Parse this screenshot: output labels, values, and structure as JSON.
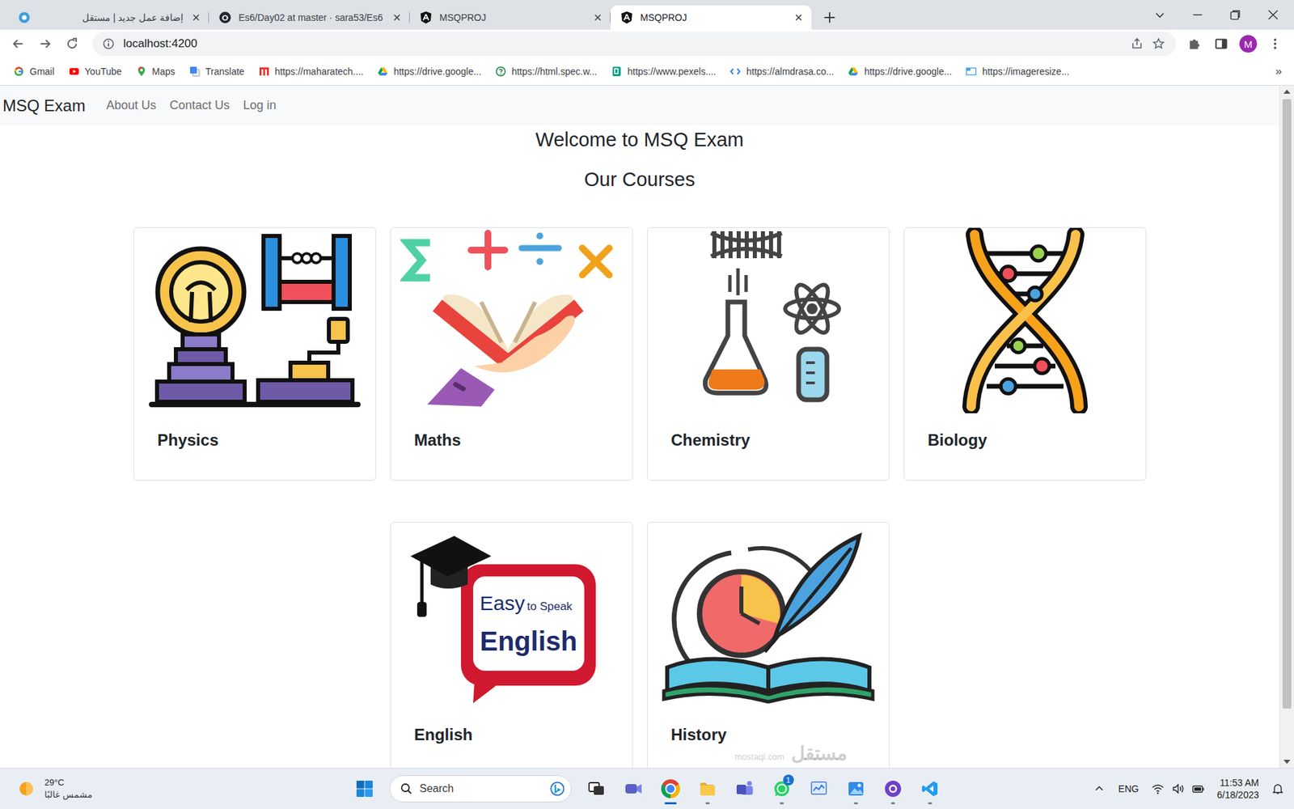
{
  "browser": {
    "tabs": [
      {
        "label": "إضافة عمل جديد | مستقل",
        "kind": "mostaql",
        "selected": false
      },
      {
        "label": "Es6/Day02 at master · sara53/Es6",
        "kind": "github",
        "selected": false
      },
      {
        "label": "MSQPROJ",
        "kind": "angular",
        "selected": false
      },
      {
        "label": "MSQPROJ",
        "kind": "angular",
        "selected": true
      }
    ],
    "address": "localhost:4200",
    "profile_initial": "M",
    "bookmarks": [
      {
        "label": "Gmail",
        "kind": "google"
      },
      {
        "label": "YouTube",
        "kind": "youtube"
      },
      {
        "label": "Maps",
        "kind": "maps"
      },
      {
        "label": "Translate",
        "kind": "translate"
      },
      {
        "label": "https://maharatech....",
        "kind": "maharatech"
      },
      {
        "label": "https://drive.google...",
        "kind": "drive"
      },
      {
        "label": "https://html.spec.w...",
        "kind": "help"
      },
      {
        "label": "https://www.pexels....",
        "kind": "pexels"
      },
      {
        "label": "https://almdrasa.co...",
        "kind": "code"
      },
      {
        "label": "https://drive.google...",
        "kind": "drive"
      },
      {
        "label": "https://imageresize...",
        "kind": "image"
      }
    ],
    "bookmarks_more": "»",
    "page_scrollbar": {
      "level": 0.93
    }
  },
  "page": {
    "brand": "MSQ Exam",
    "nav_links": [
      "About Us",
      "Contact Us",
      "Log in"
    ],
    "welcome": "Welcome to MSQ Exam",
    "courses_title": "Our Courses",
    "courses": [
      {
        "name": "Physics",
        "kind": "physics"
      },
      {
        "name": "Maths",
        "kind": "maths"
      },
      {
        "name": "Chemistry",
        "kind": "chemistry"
      },
      {
        "name": "Biology",
        "kind": "biology"
      },
      {
        "name": "English",
        "kind": "english",
        "image_text": [
          "Easy",
          "to Speak",
          "English"
        ]
      },
      {
        "name": "History",
        "kind": "history"
      }
    ]
  },
  "watermark": {
    "text": "مستقل",
    "site": "mostaql.com"
  },
  "taskbar": {
    "weather": {
      "temp": "29°C",
      "condition": "مشمس غالبًا"
    },
    "search_placeholder": "Search",
    "apps": [
      {
        "kind": "taskview",
        "running": false,
        "active": false
      },
      {
        "kind": "meet",
        "running": false,
        "active": false
      },
      {
        "kind": "chrome",
        "running": true,
        "active": true
      },
      {
        "kind": "explorer",
        "running": true,
        "active": false
      },
      {
        "kind": "teams",
        "running": false,
        "active": false
      },
      {
        "kind": "whatsapp",
        "running": true,
        "active": false,
        "badge": "1"
      },
      {
        "kind": "monitor",
        "running": false,
        "active": false
      },
      {
        "kind": "photos",
        "running": true,
        "active": false
      },
      {
        "kind": "github",
        "running": true,
        "active": false
      },
      {
        "kind": "vscode",
        "running": true,
        "active": false
      }
    ],
    "language": "ENG",
    "time": "11:53 AM",
    "date": "6/18/2023"
  }
}
